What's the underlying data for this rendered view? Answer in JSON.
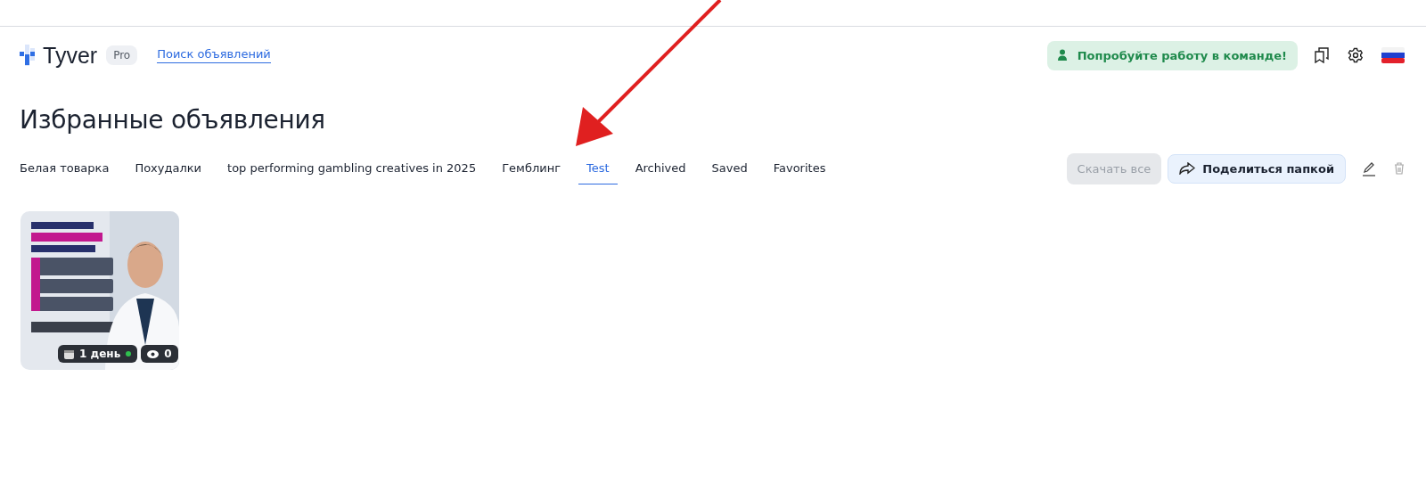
{
  "header": {
    "logo": "Tyver",
    "plan_badge": "Pro",
    "nav_link": "Поиск объявлений",
    "team_button": "Попробуйте работу в команде!"
  },
  "page_title": "Избранные объявления",
  "tabs": [
    {
      "label": "Белая товарка",
      "selected": false
    },
    {
      "label": "Похудалки",
      "selected": false
    },
    {
      "label": "top performing gambling creatives in 2025",
      "selected": false
    },
    {
      "label": "Гемблинг",
      "selected": false
    },
    {
      "label": "Test",
      "selected": true
    },
    {
      "label": "Archived",
      "selected": false
    },
    {
      "label": "Saved",
      "selected": false
    },
    {
      "label": "Favorites",
      "selected": false
    }
  ],
  "actions": {
    "download": {
      "label": "Скачать все",
      "disabled": true
    },
    "share": {
      "label": "Поделиться папкой"
    }
  },
  "ads": [
    {
      "kind": "picture",
      "age": "1 день",
      "active": true,
      "views": "0"
    }
  ]
}
